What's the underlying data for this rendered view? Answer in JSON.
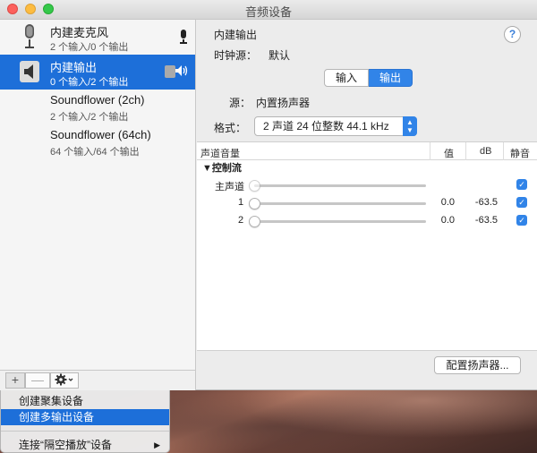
{
  "window": {
    "title": "音频设备"
  },
  "sidebar": {
    "devices": [
      {
        "name": "内建麦克风",
        "sub": "2 个输入/0 个输出",
        "icon": "microphone-icon",
        "selected": false
      },
      {
        "name": "内建输出",
        "sub": "0 个输入/2 个输出",
        "icon": "speaker-icon",
        "selected": true
      },
      {
        "name": "Soundflower (2ch)",
        "sub": "2 个输入/2 个输出",
        "icon": "",
        "selected": false
      },
      {
        "name": "Soundflower (64ch)",
        "sub": "64 个输入/64 个输出",
        "icon": "",
        "selected": false
      }
    ],
    "add_label": "+",
    "remove_label": "—"
  },
  "main": {
    "device_title": "内建输出",
    "clock_label": "时钟源：",
    "clock_value": "默认",
    "help_label": "?",
    "tabs": [
      {
        "label": "输入",
        "active": false
      },
      {
        "label": "输出",
        "active": true
      }
    ],
    "source_label": "源：",
    "source_value": "内置扬声器",
    "format_label": "格式：",
    "format_value": "2 声道 24 位整数 44.1 kHz",
    "table": {
      "headers": {
        "volume": "声道音量",
        "value": "值",
        "db": "dB",
        "mute": "静音"
      },
      "group": "控制流",
      "rows": [
        {
          "label": "主声道",
          "value": "",
          "db": "",
          "muted": true
        },
        {
          "label": "1",
          "value": "0.0",
          "db": "-63.5",
          "muted": true
        },
        {
          "label": "2",
          "value": "0.0",
          "db": "-63.5",
          "muted": true
        }
      ]
    },
    "configure_label": "配置扬声器..."
  },
  "menu": {
    "items": [
      {
        "label": "创建聚集设备",
        "selected": false
      },
      {
        "label": "创建多输出设备",
        "selected": true
      },
      {
        "label": "连接“隔空播放”设备",
        "selected": false,
        "submenu": true
      }
    ]
  },
  "colors": {
    "accent": "#3184e8",
    "selection": "#1d6fd9"
  }
}
